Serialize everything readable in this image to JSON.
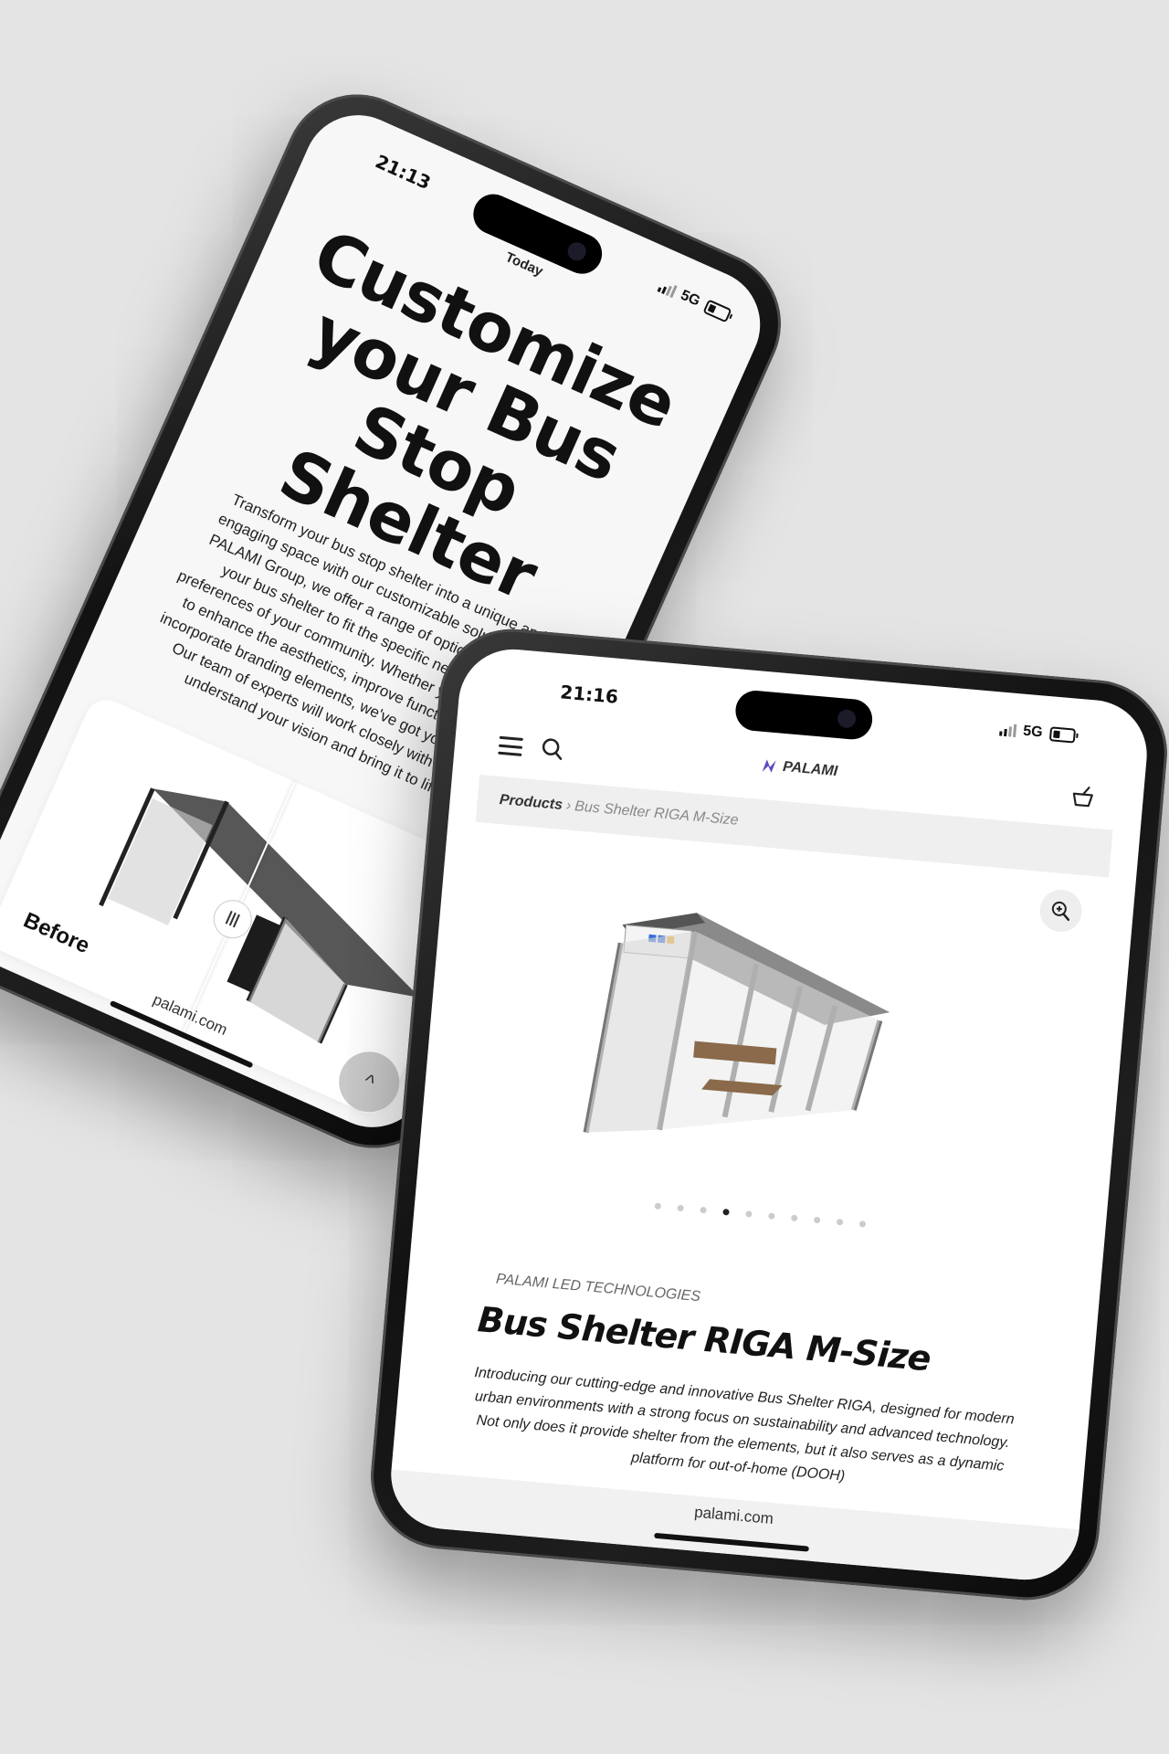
{
  "phone_left": {
    "status": {
      "time": "21:13"
    },
    "today_label": "Today",
    "hero": {
      "title": "Customize your Bus Stop Shelter",
      "text": "Transform your bus stop shelter into a unique and engaging space with our customizable solutions. At PALAMI Group, we offer a range of options to tailor your bus shelter to fit the specific needs and preferences of your community. Whether you're looking to enhance the aesthetics, improve functionality, or incorporate branding elements, we've got you covered. Our team of experts will work closely with you to understand your vision and bring it to life."
    },
    "compare": {
      "before_label": "Before",
      "handle_glyph": "|||"
    },
    "url": "palami.com",
    "scroll_top_icon": "chevron-up-icon",
    "scroll_top_glyph": "^"
  },
  "phone_right": {
    "status": {
      "time": "21:16",
      "network": "5G"
    },
    "nav": {
      "logo_text": "PALAMI",
      "menu_icon": "hamburger-icon",
      "search_icon": "search-icon",
      "cart_icon": "basket-icon"
    },
    "breadcrumb": {
      "home": "Products",
      "separator": "›",
      "current": "Bus Shelter RIGA M-Size"
    },
    "gallery": {
      "dot_count": 10,
      "active_index": 3
    },
    "product": {
      "brand": "PALAMI LED TECHNOLOGIES",
      "title": "Bus Shelter RIGA M-Size",
      "description": "Introducing our cutting-edge and innovative Bus Shelter RIGA, designed for modern urban environments with a strong focus on sustainability and advanced technology. Not only does it provide shelter from the elements, but it also serves as a dynamic platform for out-of-home (DOOH)"
    },
    "url": "palami.com"
  }
}
